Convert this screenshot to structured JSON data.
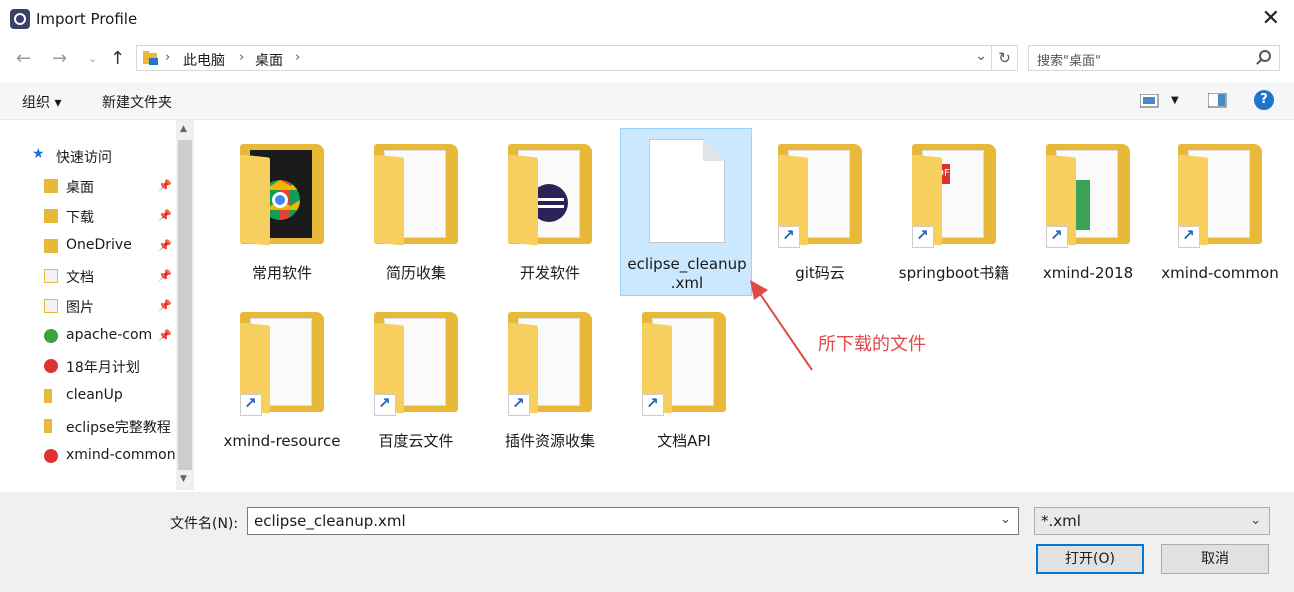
{
  "window": {
    "title": "Import Profile"
  },
  "address": {
    "breadcrumbs": [
      "此电脑",
      "桌面"
    ],
    "search_placeholder": "搜索\"桌面\""
  },
  "toolbar": {
    "organize": "组织 ▾",
    "new_folder": "新建文件夹",
    "help": "?"
  },
  "nav": {
    "items": [
      {
        "label": "快速访问",
        "icon": "star-icon"
      },
      {
        "label": "桌面",
        "icon": "folder-icon",
        "pinned": true
      },
      {
        "label": "下载",
        "icon": "download-icon",
        "pinned": true
      },
      {
        "label": "OneDrive",
        "icon": "cloud-icon",
        "pinned": true
      },
      {
        "label": "文档",
        "icon": "document-icon",
        "pinned": true
      },
      {
        "label": "图片",
        "icon": "image-icon",
        "pinned": true
      },
      {
        "label": "apache-com",
        "icon": "folder-icon",
        "pinned": true
      },
      {
        "label": "18年月计划",
        "icon": "folder-icon"
      },
      {
        "label": "cleanUp",
        "icon": "folder-icon"
      },
      {
        "label": "eclipse完整教程",
        "icon": "folder-icon"
      },
      {
        "label": "xmind-common",
        "icon": "folder-icon"
      }
    ]
  },
  "files": [
    {
      "label": "常用软件",
      "type": "folder"
    },
    {
      "label": "简历收集",
      "type": "folder"
    },
    {
      "label": "开发软件",
      "type": "folder"
    },
    {
      "label": "eclipse_cleanup.xml",
      "label2": ".xml",
      "type": "file",
      "selected": true
    },
    {
      "label": "git码云",
      "type": "folder-shortcut"
    },
    {
      "label": "springboot书籍",
      "type": "folder-shortcut"
    },
    {
      "label": "xmind-2018",
      "type": "folder-shortcut"
    },
    {
      "label": "xmind-common",
      "type": "folder-shortcut"
    },
    {
      "label": "xmind-resource",
      "type": "folder-shortcut"
    },
    {
      "label": "百度云文件",
      "type": "folder-shortcut"
    },
    {
      "label": "插件资源收集",
      "type": "folder-shortcut"
    },
    {
      "label": "文档API",
      "type": "folder-shortcut"
    }
  ],
  "selected_label_line1": "eclipse_cleanup",
  "annotation": "所下载的文件",
  "bottom": {
    "filename_label": "文件名(N):",
    "filename_value": "eclipse_cleanup.xml",
    "filter": "*.xml",
    "open": "打开(O)",
    "cancel": "取消"
  },
  "colors": {
    "accent": "#0078d7",
    "selection": "#cce8ff",
    "annotation": "#e24a4a"
  }
}
